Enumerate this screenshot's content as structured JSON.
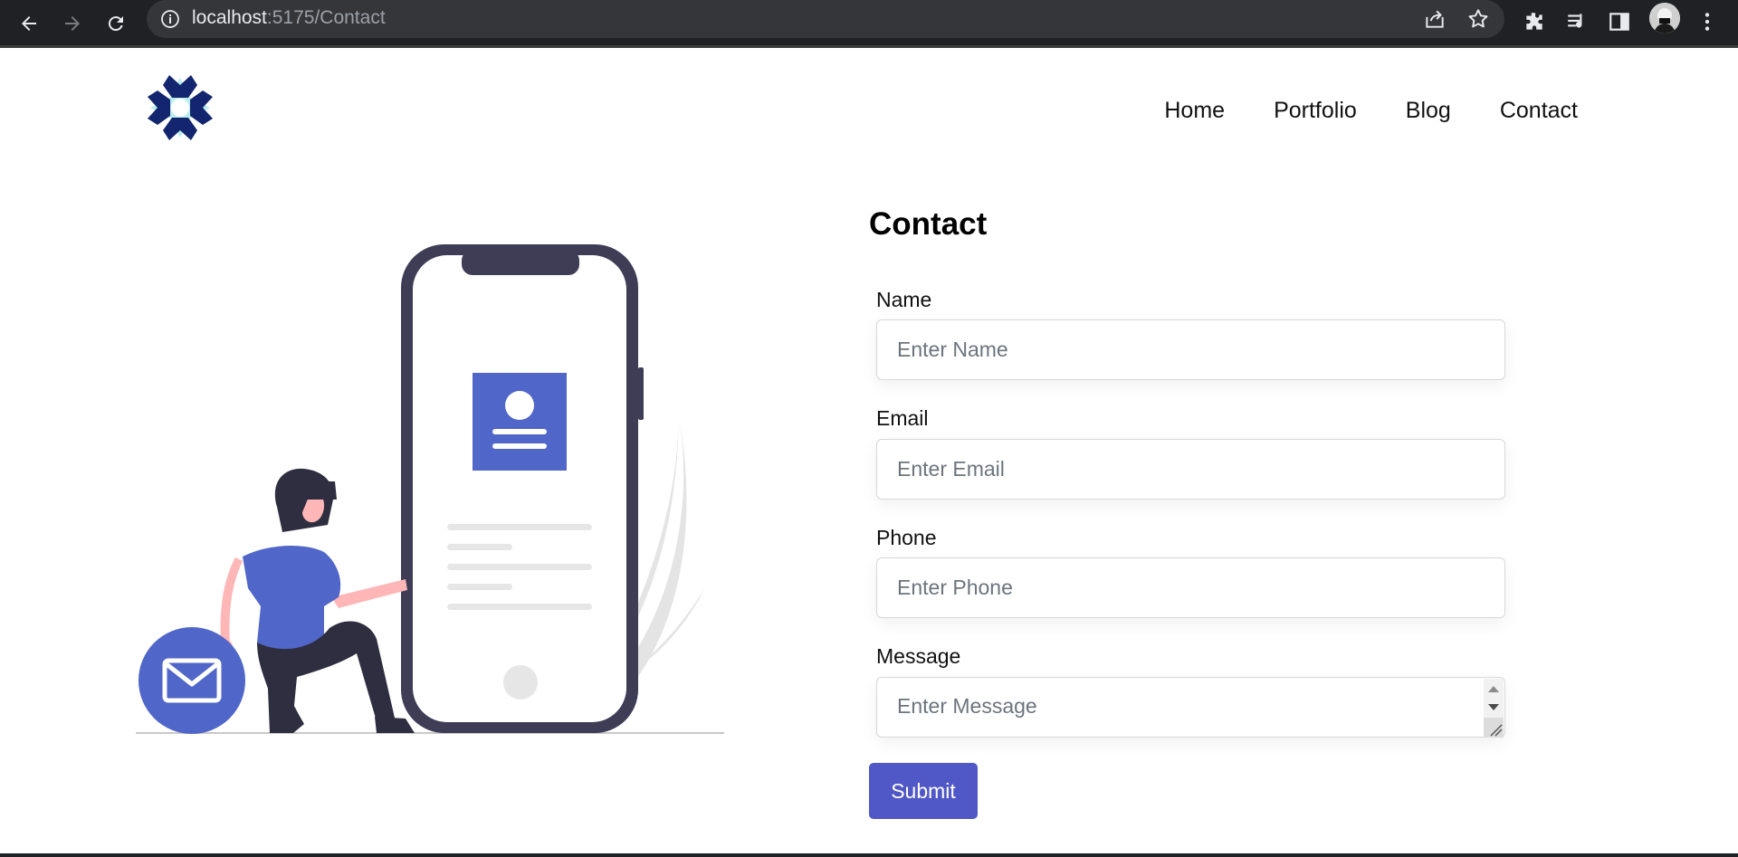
{
  "browser": {
    "url_host": "localhost",
    "url_path": ":5175/Contact"
  },
  "nav": {
    "items": [
      {
        "label": "Home"
      },
      {
        "label": "Portfolio"
      },
      {
        "label": "Blog"
      },
      {
        "label": "Contact"
      }
    ]
  },
  "form": {
    "title": "Contact",
    "fields": [
      {
        "label": "Name",
        "placeholder": "Enter Name"
      },
      {
        "label": "Email",
        "placeholder": "Enter Email"
      },
      {
        "label": "Phone",
        "placeholder": "Enter Phone"
      },
      {
        "label": "Message",
        "placeholder": "Enter Message"
      }
    ],
    "submit_label": "Submit"
  },
  "colors": {
    "accent": "#5057c6",
    "illustration_blue": "#5066c8",
    "phone_frame": "#3f3d56",
    "chrome_bg": "#202124"
  }
}
